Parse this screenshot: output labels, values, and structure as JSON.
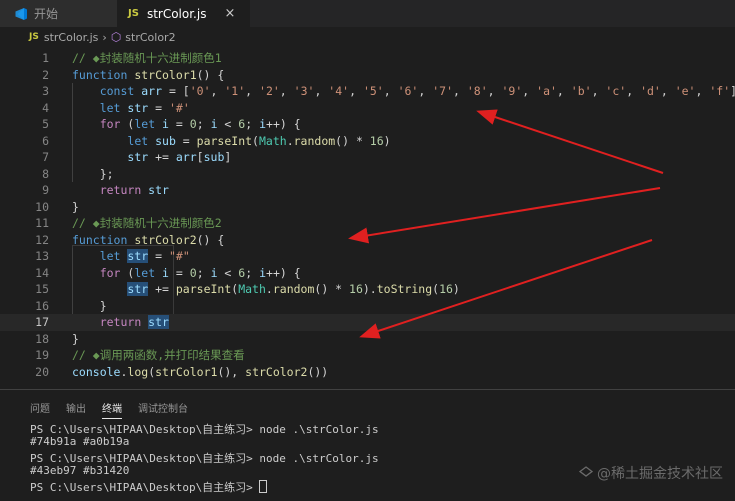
{
  "tabs": [
    {
      "label": "开始",
      "icon": "vscode-icon"
    },
    {
      "label": "strColor.js",
      "icon": "js-icon",
      "close": "×"
    }
  ],
  "breadcrumb": {
    "file_badge": "JS",
    "file": "strColor.js",
    "separator": "›",
    "symbol": "strColor2"
  },
  "code": {
    "lines": [
      {
        "n": "1",
        "tokens": [
          [
            "cm",
            "// ◆封装随机十六进制颜色1"
          ]
        ]
      },
      {
        "n": "2",
        "tokens": [
          [
            "kw",
            "function "
          ],
          [
            "fn",
            "strColor1"
          ],
          [
            "",
            "() {"
          ]
        ]
      },
      {
        "n": "3",
        "tokens": [
          [
            "",
            "    "
          ],
          [
            "kw",
            "const "
          ],
          [
            "var",
            "arr"
          ],
          [
            "",
            " = ["
          ],
          [
            "str",
            "'0'"
          ],
          [
            "",
            ", "
          ],
          [
            "str",
            "'1'"
          ],
          [
            "",
            ", "
          ],
          [
            "str",
            "'2'"
          ],
          [
            "",
            ", "
          ],
          [
            "str",
            "'3'"
          ],
          [
            "",
            ", "
          ],
          [
            "str",
            "'4'"
          ],
          [
            "",
            ", "
          ],
          [
            "str",
            "'5'"
          ],
          [
            "",
            ", "
          ],
          [
            "str",
            "'6'"
          ],
          [
            "",
            ", "
          ],
          [
            "str",
            "'7'"
          ],
          [
            "",
            ", "
          ],
          [
            "str",
            "'8'"
          ],
          [
            "",
            ", "
          ],
          [
            "str",
            "'9'"
          ],
          [
            "",
            ", "
          ],
          [
            "str",
            "'a'"
          ],
          [
            "",
            ", "
          ],
          [
            "str",
            "'b'"
          ],
          [
            "",
            ", "
          ],
          [
            "str",
            "'c'"
          ],
          [
            "",
            ", "
          ],
          [
            "str",
            "'d'"
          ],
          [
            "",
            ", "
          ],
          [
            "str",
            "'e'"
          ],
          [
            "",
            ", "
          ],
          [
            "str",
            "'f'"
          ],
          [
            "",
            "]"
          ]
        ]
      },
      {
        "n": "4",
        "tokens": [
          [
            "",
            "    "
          ],
          [
            "kw",
            "let "
          ],
          [
            "var",
            "str"
          ],
          [
            "",
            " = "
          ],
          [
            "str",
            "'#'"
          ]
        ]
      },
      {
        "n": "5",
        "tokens": [
          [
            "",
            "    "
          ],
          [
            "kw2",
            "for "
          ],
          [
            "",
            "("
          ],
          [
            "kw",
            "let "
          ],
          [
            "var",
            "i"
          ],
          [
            "",
            " = "
          ],
          [
            "num",
            "0"
          ],
          [
            "",
            "; "
          ],
          [
            "var",
            "i"
          ],
          [
            "",
            " < "
          ],
          [
            "num",
            "6"
          ],
          [
            "",
            "; "
          ],
          [
            "var",
            "i"
          ],
          [
            "",
            "++) {"
          ]
        ]
      },
      {
        "n": "6",
        "tokens": [
          [
            "",
            "        "
          ],
          [
            "kw",
            "let "
          ],
          [
            "var",
            "sub"
          ],
          [
            "",
            " = "
          ],
          [
            "fn",
            "parseInt"
          ],
          [
            "",
            "("
          ],
          [
            "cls",
            "Math"
          ],
          [
            "",
            "."
          ],
          [
            "fn",
            "random"
          ],
          [
            "",
            "() * "
          ],
          [
            "num",
            "16"
          ],
          [
            "",
            ")"
          ]
        ]
      },
      {
        "n": "7",
        "tokens": [
          [
            "",
            "        "
          ],
          [
            "var",
            "str"
          ],
          [
            "",
            " += "
          ],
          [
            "var",
            "arr"
          ],
          [
            "",
            "["
          ],
          [
            "var",
            "sub"
          ],
          [
            "",
            "]"
          ]
        ]
      },
      {
        "n": "8",
        "tokens": [
          [
            "",
            "    };"
          ]
        ]
      },
      {
        "n": "9",
        "tokens": [
          [
            "",
            "    "
          ],
          [
            "kw2",
            "return "
          ],
          [
            "var",
            "str"
          ]
        ]
      },
      {
        "n": "10",
        "tokens": [
          [
            "",
            "}"
          ]
        ]
      },
      {
        "n": "11",
        "tokens": [
          [
            "cm",
            "// ◆封装随机十六进制颜色2"
          ]
        ]
      },
      {
        "n": "12",
        "tokens": [
          [
            "kw",
            "function "
          ],
          [
            "fn",
            "strColor2"
          ],
          [
            "",
            "() {"
          ]
        ]
      },
      {
        "n": "13",
        "tokens": [
          [
            "",
            "    "
          ],
          [
            "kw",
            "let "
          ],
          [
            "var hl",
            "str"
          ],
          [
            "",
            " = "
          ],
          [
            "str",
            "\"#\""
          ]
        ]
      },
      {
        "n": "14",
        "tokens": [
          [
            "",
            "    "
          ],
          [
            "kw2",
            "for "
          ],
          [
            "",
            "("
          ],
          [
            "kw",
            "let "
          ],
          [
            "var",
            "i"
          ],
          [
            "",
            " = "
          ],
          [
            "num",
            "0"
          ],
          [
            "",
            "; "
          ],
          [
            "var",
            "i"
          ],
          [
            "",
            " < "
          ],
          [
            "num",
            "6"
          ],
          [
            "",
            "; "
          ],
          [
            "var",
            "i"
          ],
          [
            "",
            "++) {"
          ]
        ]
      },
      {
        "n": "15",
        "tokens": [
          [
            "",
            "        "
          ],
          [
            "var hl",
            "str"
          ],
          [
            "",
            " += "
          ],
          [
            "fn",
            "parseInt"
          ],
          [
            "",
            "("
          ],
          [
            "cls",
            "Math"
          ],
          [
            "",
            "."
          ],
          [
            "fn",
            "random"
          ],
          [
            "",
            "() * "
          ],
          [
            "num",
            "16"
          ],
          [
            "",
            ")."
          ],
          [
            "fn",
            "toString"
          ],
          [
            "",
            "("
          ],
          [
            "num",
            "16"
          ],
          [
            "",
            ")"
          ]
        ]
      },
      {
        "n": "16",
        "tokens": [
          [
            "",
            "    }"
          ]
        ]
      },
      {
        "n": "17",
        "tokens": [
          [
            "",
            "    "
          ],
          [
            "kw2",
            "return "
          ],
          [
            "var hl",
            "str"
          ]
        ]
      },
      {
        "n": "18",
        "tokens": [
          [
            "",
            "}"
          ]
        ]
      },
      {
        "n": "19",
        "tokens": [
          [
            "cm",
            "// ◆调用两函数,并打印结果查看"
          ]
        ]
      },
      {
        "n": "20",
        "tokens": [
          [
            "var",
            "console"
          ],
          [
            "",
            "."
          ],
          [
            "fn",
            "log"
          ],
          [
            "",
            "("
          ],
          [
            "fn",
            "strColor1"
          ],
          [
            "",
            "(), "
          ],
          [
            "fn",
            "strColor2"
          ],
          [
            "",
            "())"
          ]
        ]
      }
    ],
    "current_line": "17"
  },
  "panel": {
    "tabs": [
      "问题",
      "输出",
      "终端",
      "调试控制台"
    ],
    "active_tab": "终端",
    "terminal": [
      "PS C:\\Users\\HIPAA\\Desktop\\自主练习> node .\\strColor.js",
      "#74b91a #a0b19a",
      "PS C:\\Users\\HIPAA\\Desktop\\自主练习> node .\\strColor.js",
      "#43eb97 #b31420",
      "PS C:\\Users\\HIPAA\\Desktop\\自主练习> "
    ]
  },
  "watermark": "@稀土掘金技术社区",
  "colors": {
    "annotation_arrow": "#e02020",
    "accent": "#007acc"
  }
}
